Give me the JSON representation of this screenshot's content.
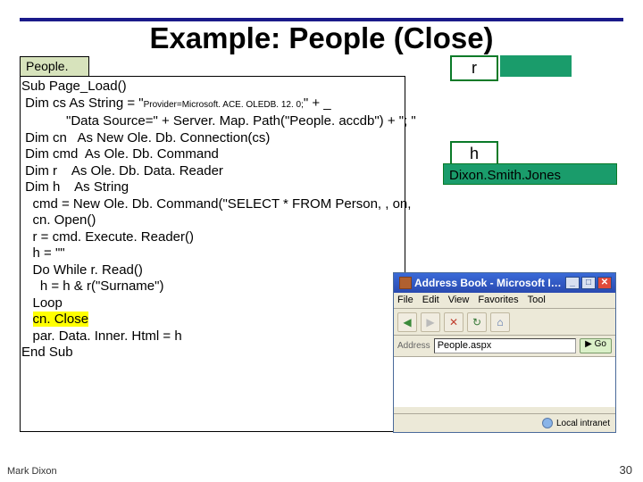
{
  "title": "Example: People (Close)",
  "pill_file": "People. as px",
  "boxes": {
    "r": "r",
    "h": "h",
    "names": "Dixon.Smith.Jones"
  },
  "code": {
    "l1": "Sub Page_Load()",
    "l2a": " Dim cs As String = \"",
    "l2b": "Provider=Microsoft. ACE. OLEDB. 12. 0;",
    "l2c": "\" + _",
    "l3": "            \"Data Source=\" + Server. Map. Path(\"People. accdb\") + \"; \"",
    "l4": " Dim cn   As New Ole. Db. Connection(cs)",
    "l5": " Dim cmd  As Ole. Db. Command",
    "l6": " Dim r    As Ole. Db. Data. Reader",
    "l7": " Dim h    As String",
    "l8": "   cmd = New Ole. Db. Command(\"SELECT * FROM Person, , on,",
    "l9": "   cn. Open()",
    "l10": "   r = cmd. Execute. Reader()",
    "l11": "   h = \"\"",
    "l12": "   Do While r. Read()",
    "l13": "     h = h & r(\"Surname\")",
    "l14": "   Loop",
    "l15a": "   ",
    "l15b": "cn. Close",
    "l16": "   par. Data. Inner. Html = h",
    "l17": "End Sub"
  },
  "browser": {
    "title": "Address Book - Microsoft I…",
    "menu": [
      "File",
      "Edit",
      "View",
      "Favorites",
      "Tool"
    ],
    "addr_label": "Address",
    "addr_value": "People.aspx",
    "go": "Go",
    "status": "Local intranet"
  },
  "footer": {
    "left": "Mark Dixon",
    "right": "30"
  }
}
